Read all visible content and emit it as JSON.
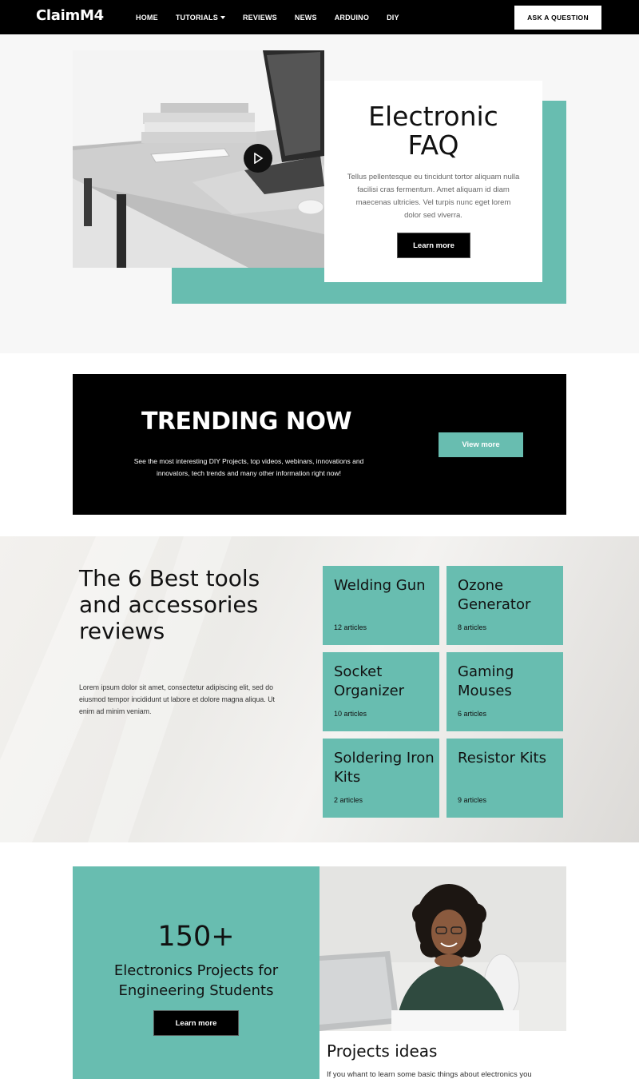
{
  "nav": {
    "logo": "ClaimM4",
    "items": [
      {
        "label": "HOME"
      },
      {
        "label": "TUTORIALS",
        "dropdown": true
      },
      {
        "label": "REVIEWS"
      },
      {
        "label": "NEWS"
      },
      {
        "label": "ARDUINO"
      },
      {
        "label": "DIY"
      }
    ],
    "cta": "ASK A QUESTION"
  },
  "hero": {
    "title_line1": "Electronic",
    "title_line2": "FAQ",
    "text": "Tellus pellentesque eu tincidunt tortor aliquam nulla facilisi cras fermentum. Amet aliquam id diam maecenas ultricies. Vel turpis nunc eget lorem dolor sed viverra.",
    "button": "Learn more"
  },
  "trending": {
    "title": "TRENDING NOW",
    "text": "See  the most interesting DIY Projects, top videos, webinars, innovations and innovators, tech trends and many other information right now!",
    "button": "View more"
  },
  "tools": {
    "title": "The 6 Best tools and accessories reviews",
    "text": "Lorem ipsum dolor sit amet, consectetur adipiscing elit, sed do eiusmod tempor incididunt ut labore et dolore magna aliqua. Ut enim ad minim veniam.",
    "tiles": [
      {
        "name": "Welding Gun",
        "count": "12 articles"
      },
      {
        "name": "Ozone Generator",
        "count": "8 articles"
      },
      {
        "name": "Socket Organizer",
        "count": "10 articles"
      },
      {
        "name": "Gaming Mouses",
        "count": "6 articles"
      },
      {
        "name": "Soldering Iron Kits",
        "count": "2 articles"
      },
      {
        "name": "Resistor Kits",
        "count": "9 articles"
      }
    ]
  },
  "projects": {
    "count": "150+",
    "subtitle": "Electronics Projects for Engineering Students",
    "button": "Learn more",
    "ideas_title": "Projects ideas",
    "ideas_text": "If you whant to learn some basic things about electronics you"
  },
  "colors": {
    "accent": "#68bdb0",
    "nav_bg": "#000000",
    "hero_bg": "#f7f7f7"
  }
}
